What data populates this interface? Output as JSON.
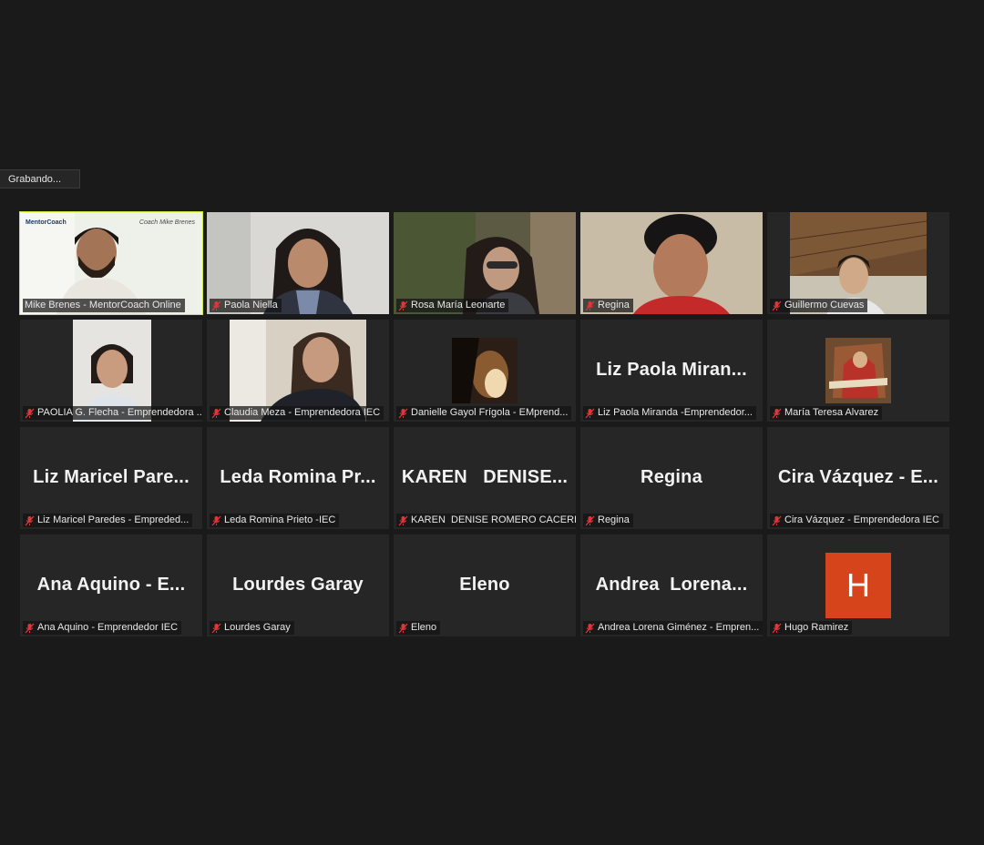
{
  "recording": {
    "label": "Grabando..."
  },
  "tiles": [
    {
      "tag": "Mike Brenes - MentorCoach Online",
      "logo": "MentorCoach",
      "signature": "Coach Mike Brenes",
      "type": "video",
      "active": true
    },
    {
      "tag": "Paola Niella",
      "type": "video"
    },
    {
      "tag": "Rosa María Leonarte",
      "type": "video"
    },
    {
      "tag": "Regina",
      "type": "video"
    },
    {
      "tag": "Guillermo Cuevas",
      "type": "video"
    },
    {
      "tag": "PAOLIA G. Flecha - Emprendedora ...",
      "type": "video-small"
    },
    {
      "tag": "Claudia Meza - Emprendedora IEC",
      "type": "video"
    },
    {
      "tag": "Danielle Gayol Frígola - EMprend...",
      "type": "photo"
    },
    {
      "tag": "Liz Paola Miranda -Emprendedor...",
      "big": "Liz Paola Miran...",
      "type": "name"
    },
    {
      "tag": "María Teresa Alvarez",
      "type": "photo"
    },
    {
      "tag": "Liz Maricel Paredes - Empreded...",
      "big": "Liz Maricel Pare...",
      "type": "name"
    },
    {
      "tag": "Leda Romina Prieto -IEC",
      "big": "Leda Romina Pr...",
      "type": "name"
    },
    {
      "tag": "KAREN  DENISE ROMERO CACERES",
      "big": "KAREN   DENISE...",
      "type": "name"
    },
    {
      "tag": "Regina",
      "big": "Regina",
      "type": "name"
    },
    {
      "tag": "Cira Vázquez - Emprendedora IEC",
      "big": "Cira Vázquez - E...",
      "type": "name"
    },
    {
      "tag": "Ana Aquino - Emprendedor IEC",
      "big": "Ana Aquino - E...",
      "type": "name"
    },
    {
      "tag": "Lourdes Garay",
      "big": "Lourdes Garay",
      "type": "name"
    },
    {
      "tag": "Eleno",
      "big": "Eleno",
      "type": "name"
    },
    {
      "tag": "Andrea Lorena Giménez - Empren...",
      "big": "Andrea  Lorena...",
      "type": "name"
    },
    {
      "tag": "Hugo Ramirez",
      "avatar_letter": "H",
      "avatar_color": "#d5441a",
      "type": "avatar"
    }
  ],
  "icons": {
    "muted": "mic-muted-icon"
  },
  "colors": {
    "active_speaker": "#c9e831",
    "muted_icon": "#e0363a",
    "background": "#1a1a1a",
    "tile": "#262626"
  }
}
